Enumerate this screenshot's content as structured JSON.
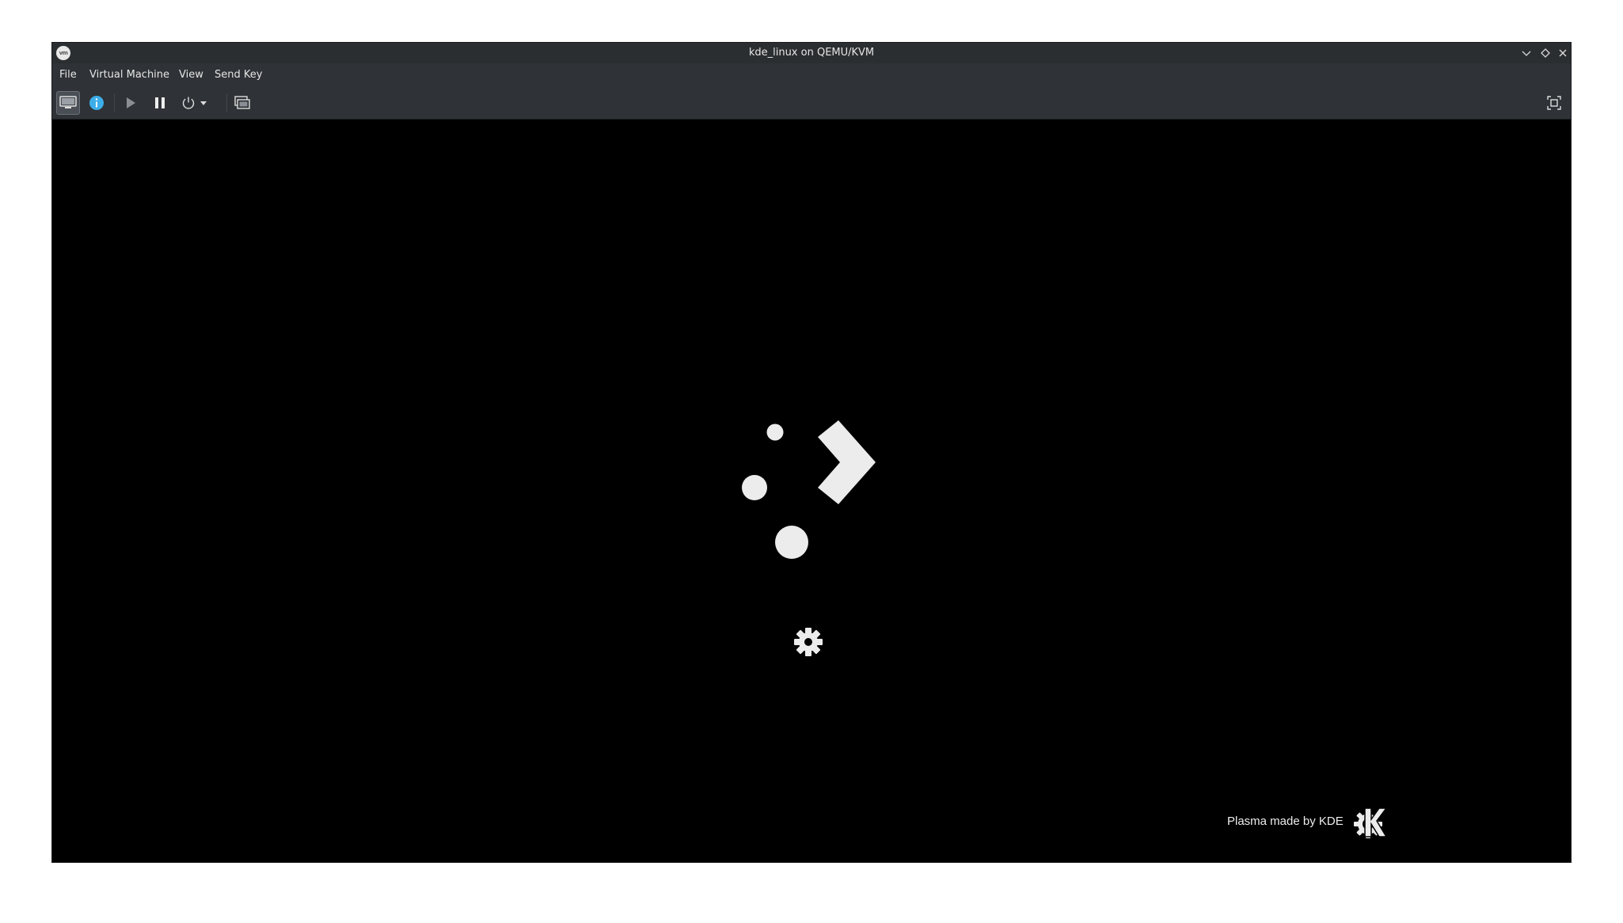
{
  "window": {
    "title": "kde_linux on QEMU/KVM",
    "app_icon_text": "vm"
  },
  "menubar": {
    "items": [
      "File",
      "Virtual Machine",
      "View",
      "Send Key"
    ]
  },
  "toolbar": {
    "buttons": [
      {
        "icon": "console-icon",
        "active": true
      },
      {
        "icon": "info-icon",
        "active": false
      },
      {
        "icon": "play-icon",
        "active": false
      },
      {
        "icon": "pause-icon",
        "active": false
      },
      {
        "icon": "power-icon",
        "active": false
      },
      {
        "icon": "dropdown-arrow-icon",
        "active": false
      },
      {
        "icon": "snapshots-icon",
        "active": false
      },
      {
        "icon": "fullscreen-icon",
        "active": false
      }
    ]
  },
  "guest_screen": {
    "splash_branding": "Plasma made by KDE"
  },
  "colors": {
    "titlebar_bg": "#2b2e31",
    "toolbar_bg": "#2f3236",
    "display_bg": "#000000",
    "info_accent": "#3daee9"
  }
}
